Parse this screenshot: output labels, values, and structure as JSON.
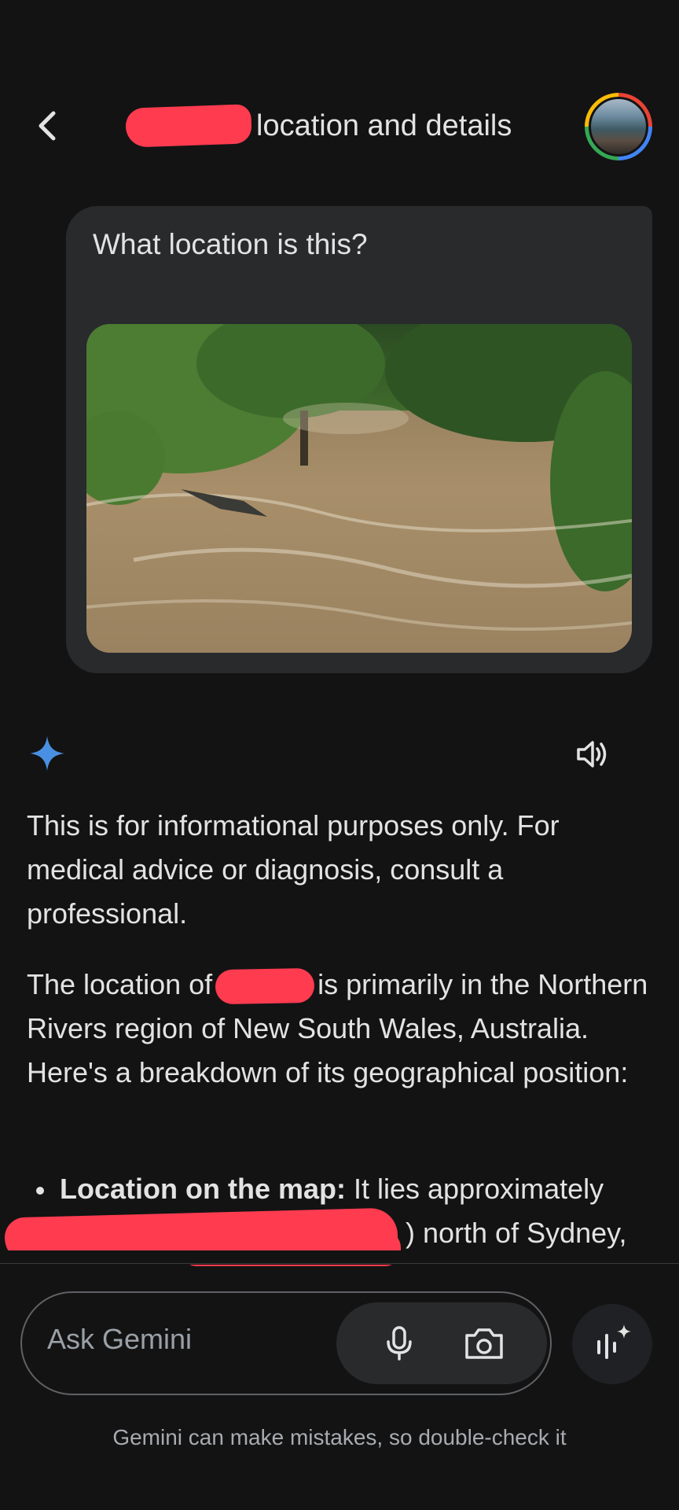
{
  "header": {
    "title_suffix": "location and details"
  },
  "user_message": {
    "text": "What location is this?"
  },
  "response": {
    "disclaimer": "This is for informational purposes only. For medical advice or diagnosis, consult a professional.",
    "para_prefix": "The location of",
    "para_suffix": "is primarily in the Northern Rivers region of New South Wales, Australia. Here's a breakdown of its geographical position:",
    "bullet_label": "Location on the map:",
    "bullet_text": " It lies approximately",
    "bullet_line2": ") north of Sydney,"
  },
  "input": {
    "placeholder": "Ask Gemini"
  },
  "footer": {
    "disclaimer": "Gemini can make mistakes, so double-check it"
  },
  "icons": {
    "back": "chevron-left-icon",
    "spark": "gemini-spark-icon",
    "speaker": "speaker-icon",
    "mic": "mic-icon",
    "camera": "camera-icon",
    "live": "live-voice-icon"
  },
  "colors": {
    "background": "#131314",
    "bubble": "#282a2c",
    "redaction": "#ff3b4f",
    "accent_spark": "#4a90e2"
  }
}
